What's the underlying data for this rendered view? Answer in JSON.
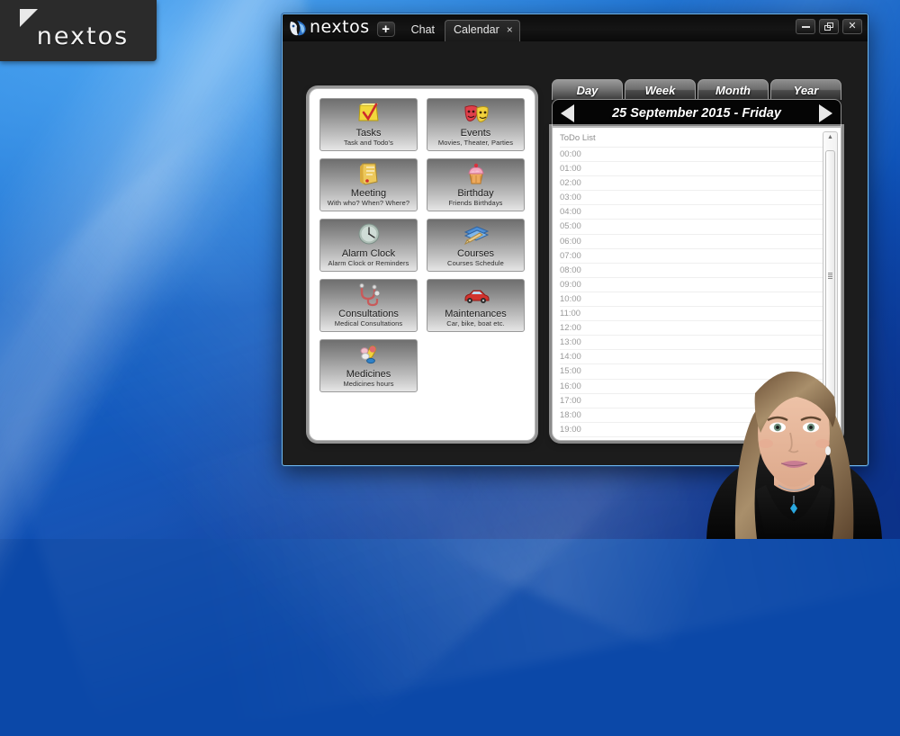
{
  "desktop": {
    "logo_word": "nextos",
    "logo_mark_icon": "triangle-mark-icon"
  },
  "window": {
    "brand": "nextos",
    "brand_face_icon": "nextos-face-logo-icon",
    "add_tab_label": "+",
    "tabs": [
      {
        "label": "Chat",
        "active": false
      },
      {
        "label": "Calendar",
        "active": true,
        "close_label": "×"
      }
    ],
    "controls": {
      "minimize_icon": "minimize-icon",
      "restore_icon": "restore-icon",
      "close_label": "✕"
    }
  },
  "left_panel": {
    "cards": [
      {
        "title": "Tasks",
        "subtitle": "Task and Todo's",
        "icon": "yellow-note-check-icon"
      },
      {
        "title": "Events",
        "subtitle": "Movies, Theater, Parties",
        "icon": "theater-masks-icon"
      },
      {
        "title": "Meeting",
        "subtitle": "With who? When? Where?",
        "icon": "notepad-folder-icon"
      },
      {
        "title": "Birthday",
        "subtitle": "Friends Birthdays",
        "icon": "cupcake-icon"
      },
      {
        "title": "Alarm Clock",
        "subtitle": "Alarm Clock or Reminders",
        "icon": "clock-icon"
      },
      {
        "title": "Courses",
        "subtitle": "Courses Schedule",
        "icon": "books-pencil-icon"
      },
      {
        "title": "Consultations",
        "subtitle": "Medical Consultations",
        "icon": "stethoscope-icon"
      },
      {
        "title": "Maintenances",
        "subtitle": "Car, bike, boat etc.",
        "icon": "red-car-icon"
      },
      {
        "title": "Medicines",
        "subtitle": "Medicines hours",
        "icon": "pills-icon"
      }
    ]
  },
  "right_panel": {
    "view_tabs": [
      {
        "label": "Day",
        "active": true
      },
      {
        "label": "Week",
        "active": false
      },
      {
        "label": "Month",
        "active": false
      },
      {
        "label": "Year",
        "active": false
      }
    ],
    "prev_icon": "left-arrow-icon",
    "next_icon": "right-arrow-icon",
    "date_text": "25 September 2015 - Friday",
    "list_header": "ToDo List",
    "hours": [
      "00:00",
      "01:00",
      "02:00",
      "03:00",
      "04:00",
      "05:00",
      "06:00",
      "07:00",
      "08:00",
      "09:00",
      "10:00",
      "11:00",
      "12:00",
      "13:00",
      "14:00",
      "15:00",
      "16:00",
      "17:00",
      "18:00",
      "19:00"
    ],
    "scrollbar": {
      "up_icon": "scroll-up-icon",
      "down_icon": "scroll-down-icon",
      "grip_icon": "scroll-grip-icon"
    }
  },
  "avatar": {
    "name": "assistant-avatar",
    "description": "3D female assistant avatar"
  },
  "colors": {
    "desktop_blue": "#1464c8",
    "window_frame": "#6fb6ee",
    "window_body": "#1c1c1c",
    "panel_white": "#ffffff",
    "card_gray": "#8d8d8d"
  }
}
